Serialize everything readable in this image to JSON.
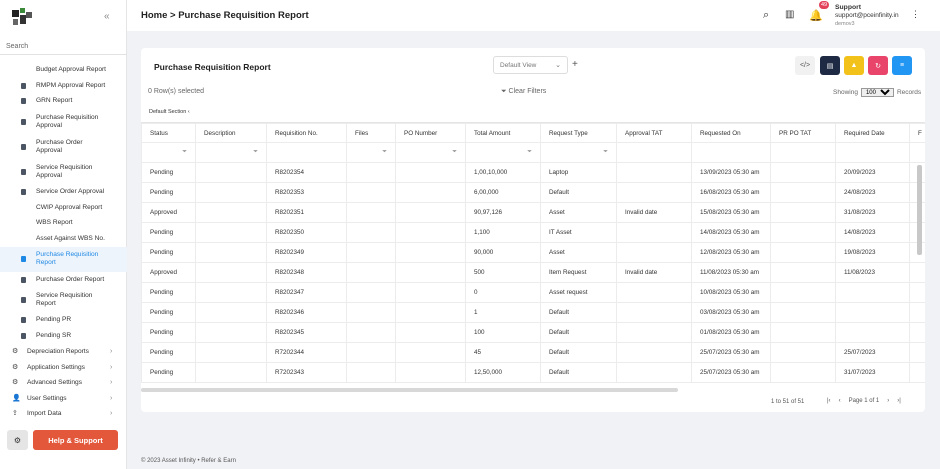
{
  "sidebar": {
    "search_label": "Search",
    "items": [
      {
        "label": "Budget Approval Report",
        "active": false,
        "icon": false
      },
      {
        "label": "RMPM Approval Report",
        "active": false,
        "icon": true
      },
      {
        "label": "GRN Report",
        "active": false,
        "icon": true
      },
      {
        "label": "Purchase Requisition Approval",
        "active": false,
        "icon": true
      },
      {
        "label": "Purchase Order Approval",
        "active": false,
        "icon": true
      },
      {
        "label": "Service Requisition Approval",
        "active": false,
        "icon": true
      },
      {
        "label": "Service Order Approval",
        "active": false,
        "icon": true
      },
      {
        "label": "CWIP Approval Report",
        "active": false,
        "icon": false
      },
      {
        "label": "WBS Report",
        "active": false,
        "icon": false
      },
      {
        "label": "Asset Against WBS No.",
        "active": false,
        "icon": false
      },
      {
        "label": "Purchase Requisition Report",
        "active": true,
        "icon": true
      },
      {
        "label": "Purchase Order Report",
        "active": false,
        "icon": true
      },
      {
        "label": "Service Requisition Report",
        "active": false,
        "icon": true
      },
      {
        "label": "Pending PR",
        "active": false,
        "icon": true
      },
      {
        "label": "Pending SR",
        "active": false,
        "icon": true
      }
    ],
    "groups": [
      {
        "label": "Depreciation Reports",
        "icon": "depreciation-icon"
      },
      {
        "label": "Application Settings",
        "icon": "application-settings-icon"
      },
      {
        "label": "Advanced Settings",
        "icon": "advanced-settings-icon"
      },
      {
        "label": "User Settings",
        "icon": "user-settings-icon"
      },
      {
        "label": "Import Data",
        "icon": "import-data-icon"
      }
    ],
    "help_label": "Help & Support"
  },
  "header": {
    "breadcrumb": "Home > Purchase Requisition Report",
    "notification_count": "49",
    "support_title": "Support",
    "support_email": "support@pceinfinity.in",
    "support_sub": "demov3"
  },
  "report": {
    "title": "Purchase Requisition Report",
    "view": "Default View",
    "rows_selected": "0  Row(s) selected",
    "clear_filters": "Clear Filters",
    "showing": "Showing",
    "page_size": "100",
    "records": "Records",
    "section": "Default Section",
    "columns": [
      "Status",
      "Description",
      "Requisition No.",
      "Files",
      "PO Number",
      "Total Amount",
      "Request Type",
      "Approval TAT",
      "Requested On",
      "PR PO TAT",
      "Required Date",
      "F"
    ],
    "rows": [
      [
        "Pending",
        "",
        "R8202354",
        "",
        "",
        "1,00,10,000",
        "Laptop",
        "",
        "13/09/2023 05:30 am",
        "",
        "20/09/2023",
        ""
      ],
      [
        "Pending",
        "",
        "R8202353",
        "",
        "",
        "6,00,000",
        "Default",
        "",
        "16/08/2023 05:30 am",
        "",
        "24/08/2023",
        ""
      ],
      [
        "Approved",
        "",
        "R8202351",
        "",
        "",
        "90,97,126",
        "Asset",
        "Invalid date",
        "15/08/2023 05:30 am",
        "",
        "31/08/2023",
        ""
      ],
      [
        "Pending",
        "",
        "R8202350",
        "",
        "",
        "1,100",
        "IT Asset",
        "",
        "14/08/2023 05:30 am",
        "",
        "14/08/2023",
        ""
      ],
      [
        "Pending",
        "",
        "R8202349",
        "",
        "",
        "90,000",
        "Asset",
        "",
        "12/08/2023 05:30 am",
        "",
        "19/08/2023",
        ""
      ],
      [
        "Approved",
        "",
        "R8202348",
        "",
        "",
        "500",
        "Item Request",
        "Invalid date",
        "11/08/2023 05:30 am",
        "",
        "11/08/2023",
        ""
      ],
      [
        "Pending",
        "",
        "R8202347",
        "",
        "",
        "0",
        "Asset request",
        "",
        "10/08/2023 05:30 am",
        "",
        "",
        ""
      ],
      [
        "Pending",
        "",
        "R8202346",
        "",
        "",
        "1",
        "Default",
        "",
        "03/08/2023 05:30 am",
        "",
        "",
        ""
      ],
      [
        "Pending",
        "",
        "R8202345",
        "",
        "",
        "100",
        "Default",
        "",
        "01/08/2023 05:30 am",
        "",
        "",
        ""
      ],
      [
        "Pending",
        "",
        "R7202344",
        "",
        "",
        "45",
        "Default",
        "",
        "25/07/2023 05:30 am",
        "",
        "25/07/2023",
        ""
      ],
      [
        "Pending",
        "",
        "R7202343",
        "",
        "",
        "12,50,000",
        "Default",
        "",
        "25/07/2023 05:30 am",
        "",
        "31/07/2023",
        ""
      ]
    ],
    "range": "1 to 51 of 51",
    "page": "Page 1 of 1"
  },
  "toolbar_colors": {
    "code": "#f1f1f1",
    "pdf": "#1e2a44",
    "excel": "#f2c21b",
    "refresh": "#e9456b",
    "columns": "#2196f3"
  },
  "footer": "© 2023  Asset Infinity • Refer & Earn"
}
